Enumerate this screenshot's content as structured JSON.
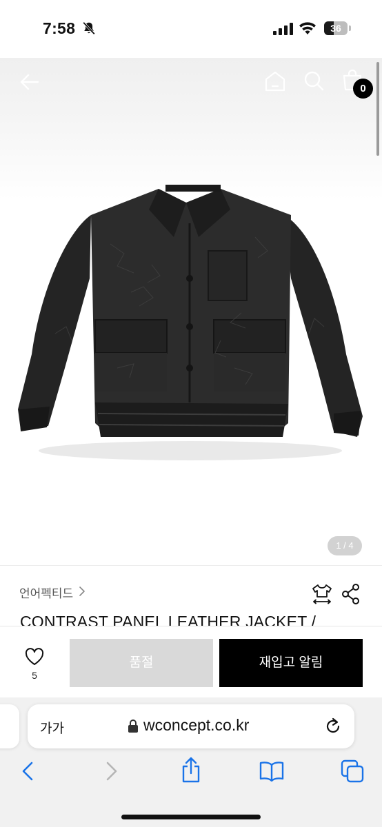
{
  "status_bar": {
    "time": "7:58",
    "battery": "36",
    "icons": [
      "bell-slash-icon",
      "cellular-signal-icon",
      "wifi-icon",
      "battery-icon"
    ]
  },
  "header": {
    "icons": [
      "back-arrow-icon",
      "home-icon",
      "search-icon",
      "shopping-bag-icon"
    ],
    "cart_count": "0"
  },
  "gallery": {
    "page_counter": "1 / 4",
    "image": "black-leather-jacket-photo"
  },
  "product": {
    "brand": "언어펙티드",
    "title": "CONTRAST PANEL LEATHER JACKET /",
    "icons": [
      "size-guide-icon",
      "share-icon"
    ]
  },
  "purchase_bar": {
    "like_count": "5",
    "soldout_label": "품절",
    "restock_label": "재입고 알림"
  },
  "browser": {
    "text_size_label": "가가",
    "url": "wconcept.co.kr",
    "toolbar_icons": [
      "back-icon",
      "forward-icon",
      "share-icon",
      "bookmarks-icon",
      "tabs-icon"
    ]
  },
  "colors": {
    "primary_button": "#000000",
    "disabled_button": "#d9d9d9",
    "badge": "#000000"
  }
}
